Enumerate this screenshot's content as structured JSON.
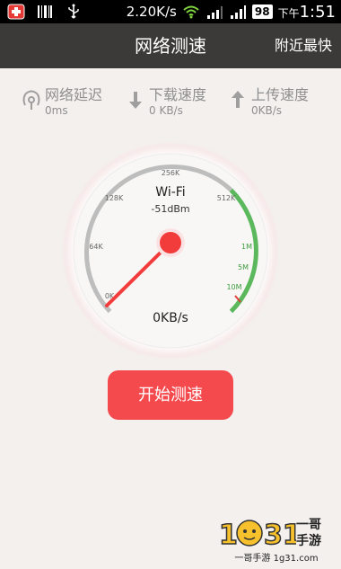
{
  "status_bar": {
    "speed": "2.20K/s",
    "battery": "98",
    "time_prefix": "下午",
    "time": "1:51"
  },
  "header": {
    "title": "网络测速",
    "action": "附近最快"
  },
  "stats": [
    {
      "label": "网络延迟",
      "value": "0ms",
      "icon": "ping-icon"
    },
    {
      "label": "下载速度",
      "value": "0 KB/s",
      "icon": "download-arrow-icon"
    },
    {
      "label": "上传速度",
      "value": "0KB/s",
      "icon": "upload-arrow-icon"
    }
  ],
  "gauge": {
    "network": "Wi-Fi",
    "signal": "-51dBm",
    "speed": "0KB/s",
    "ticks": [
      "0K",
      "64K",
      "128K",
      "256K",
      "512K",
      "1M",
      "5M",
      "10M"
    ],
    "needle_value_kbps": 0,
    "colors": {
      "track": "#bdbdbd",
      "fast": "#5cb85c",
      "needle": "#f23c3c"
    }
  },
  "start_button": {
    "label": "开始测速"
  },
  "watermark": {
    "line1": "一哥",
    "line2": "手游",
    "url": "一哥手游 1g31.com"
  }
}
